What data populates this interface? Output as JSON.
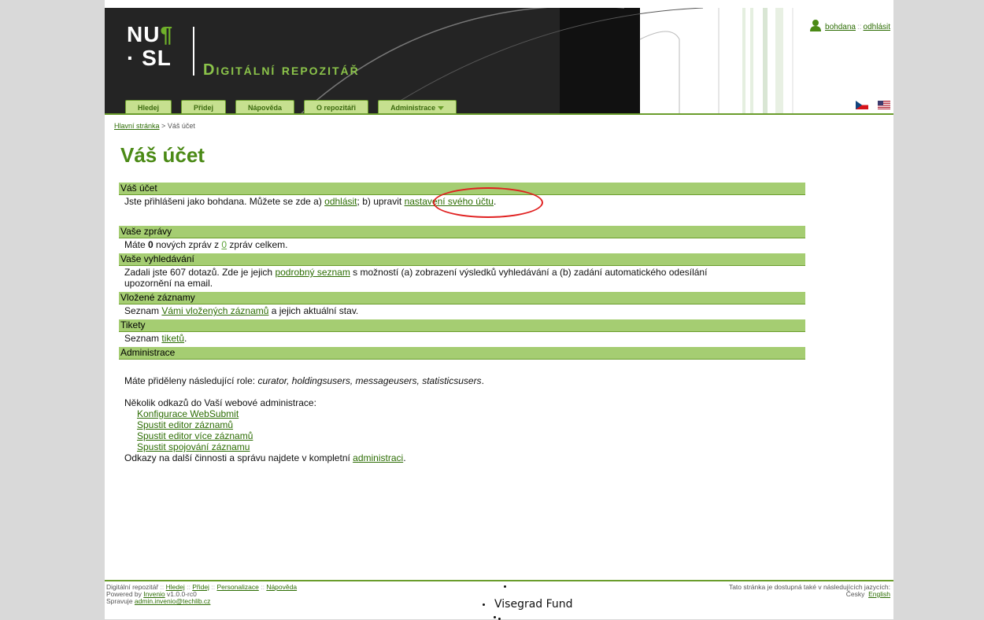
{
  "header": {
    "logo_line1": "NU",
    "logo_para": "¶",
    "logo_line2": "· SL",
    "title": "Digitální repozitář",
    "nav": [
      "Hledej",
      "Přidej",
      "Nápověda",
      "O repozitáři",
      "Administrace"
    ],
    "user": {
      "name": "bohdana",
      "separator": "::",
      "logout": "odhlásit"
    },
    "flags": [
      "cz-flag-icon",
      "us-flag-icon"
    ]
  },
  "breadcrumb": {
    "home": "Hlavní stránka",
    "separator": ">",
    "current": "Váš účet"
  },
  "page_title": "Váš účet",
  "sections": {
    "account": {
      "title": "Váš účet",
      "text_before": "Jste přihlášeni jako bohdana. Můžete se zde a) ",
      "logout_link": "odhlásit",
      "text_mid": "; b) upravit ",
      "settings_link": "nastavení svého účtu",
      "text_after": "."
    },
    "messages": {
      "title": "Vaše zprávy",
      "text1": "Máte ",
      "new_count": "0",
      "text2": " nových zpráv z ",
      "total_link": "0",
      "text3": " zpráv celkem."
    },
    "searches": {
      "title": "Vaše vyhledávání",
      "text1": "Zadali jste 607 dotazů. Zde je jejich ",
      "link": "podrobný seznam",
      "text2": " s možností (a) zobrazení výsledků vyhledávání a (b) zadání automatického odesílání upozornění na email."
    },
    "submissions": {
      "title": "Vložené záznamy",
      "text1": "Seznam ",
      "link": "Vámi vložených záznamů",
      "text2": " a jejich aktuální stav."
    },
    "tickets": {
      "title": "Tikety",
      "text1": "Seznam ",
      "link": "tiketů",
      "text2": "."
    },
    "admin": {
      "title": "Administrace",
      "roles_text": "Máte přiděleny následující role: ",
      "roles": "curator, holdingsusers, messageusers, statisticsusers",
      "roles_end": ".",
      "links_intro": "Několik odkazů do Vaší webové administrace:",
      "links": [
        "Konfigurace WebSubmit",
        "Spustit editor záznamů",
        "Spustit editor více záznamů",
        "Spustit spojování záznamu"
      ],
      "more_text": "Odkazy na další činnosti a správu najdete v kompletní ",
      "more_link": "administraci",
      "more_end": "."
    }
  },
  "footer": {
    "site": "Digitální repozitář",
    "sep": "::",
    "links": [
      "Hledej",
      "Přidej",
      "Personalizace",
      "Nápověda"
    ],
    "powered_text": "Powered by ",
    "powered_link": "Invenio",
    "version": " v1.0.0-rc0",
    "maintained_text": "Spravuje ",
    "maintained_link": "admin.invenio@techlib.cz",
    "languages_text": "Tato stránka je dostupná také v následujících jazycích:",
    "lang_current": "Česky",
    "lang_other": "English",
    "visegrad": "Visegrad Fund"
  },
  "colors": {
    "accent": "#4b8a16",
    "section_bar": "#a5cd72",
    "header_dark": "#242424",
    "highlight": "#e02020"
  }
}
